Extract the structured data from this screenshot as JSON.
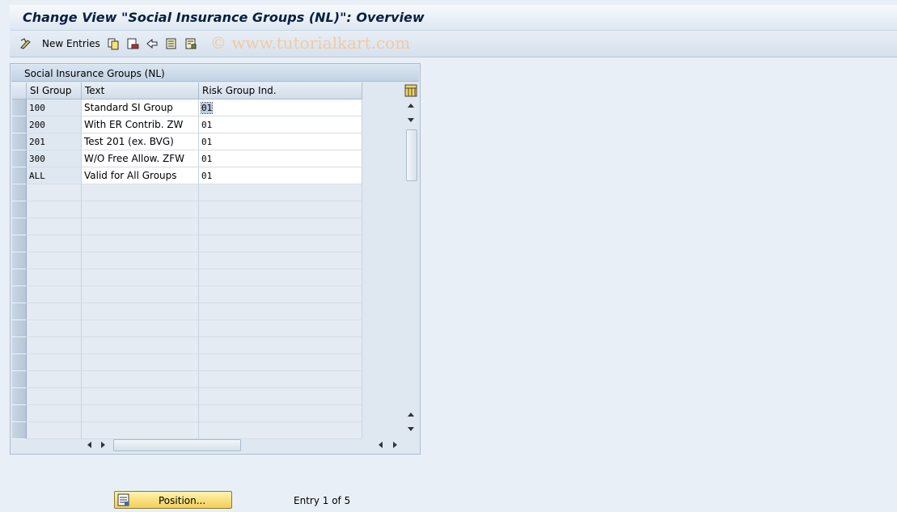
{
  "window": {
    "title": "Change View \"Social Insurance Groups (NL)\": Overview"
  },
  "toolbar": {
    "new_entries_label": "New Entries",
    "watermark": "© www.tutorialkart.com",
    "icons": [
      "edit-toggle-icon",
      "copy-icon",
      "delete-icon",
      "undo-icon",
      "select-all-icon",
      "deselect-all-icon"
    ]
  },
  "table": {
    "caption": "Social Insurance Groups (NL)",
    "columns": [
      "SI Group",
      "Text",
      "Risk Group Ind."
    ],
    "rows": [
      {
        "si_group": "100",
        "text": "Standard SI Group",
        "risk": "01"
      },
      {
        "si_group": "200",
        "text": "With ER Contrib. ZW",
        "risk": "01"
      },
      {
        "si_group": "201",
        "text": "Test 201 (ex. BVG)",
        "risk": "01"
      },
      {
        "si_group": "300",
        "text": "W/O Free Allow. ZFW",
        "risk": "01"
      },
      {
        "si_group": "ALL",
        "text": "Valid for All Groups",
        "risk": "01"
      }
    ],
    "empty_rows": 15
  },
  "footer": {
    "position_button": "Position...",
    "entry_info": "Entry 1 of 5"
  },
  "colors": {
    "background": "#e9eff6",
    "button_yellow": "#f3cf55",
    "title_text": "#0b1f3f"
  }
}
